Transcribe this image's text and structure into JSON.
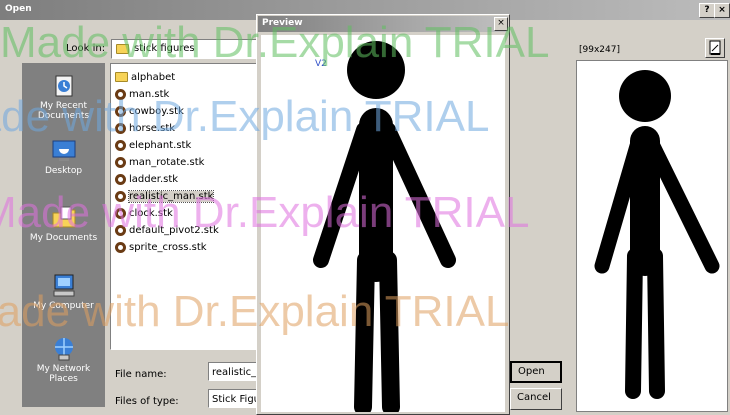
{
  "dialog": {
    "title": "Open",
    "help_label": "?",
    "close_label": "×",
    "look_in_label": "Look in:",
    "look_in_value": "stick figures",
    "dims_text": "[99x247]",
    "file_name_label": "File name:",
    "file_name_value": "realistic_m",
    "file_type_label": "Files of type:",
    "file_type_value": "Stick Figu",
    "open_label": "Open",
    "cancel_label": "Cancel"
  },
  "places": [
    {
      "label": "My Recent Documents",
      "icon": "recent-documents-icon"
    },
    {
      "label": "Desktop",
      "icon": "desktop-icon"
    },
    {
      "label": "My Documents",
      "icon": "my-documents-icon"
    },
    {
      "label": "My Computer",
      "icon": "my-computer-icon"
    },
    {
      "label": "My Network Places",
      "icon": "network-places-icon"
    }
  ],
  "files": [
    {
      "name": "alphabet",
      "type": "folder"
    },
    {
      "name": "man.stk",
      "type": "stk"
    },
    {
      "name": "cowboy.stk",
      "type": "stk"
    },
    {
      "name": "horse.stk",
      "type": "stk"
    },
    {
      "name": "elephant.stk",
      "type": "stk"
    },
    {
      "name": "man_rotate.stk",
      "type": "stk"
    },
    {
      "name": "ladder.stk",
      "type": "stk"
    },
    {
      "name": "realistic_man.stk",
      "type": "stk",
      "selected": true
    },
    {
      "name": "clock.stk",
      "type": "stk"
    },
    {
      "name": "default_pivot2.stk",
      "type": "stk"
    },
    {
      "name": "sprite_cross.stk",
      "type": "stk"
    }
  ],
  "preview_window": {
    "title": "Preview",
    "close_label": "×",
    "version_label": "V2"
  },
  "watermark": {
    "text": "Made with Dr.Explain TRIAL",
    "colors": [
      "#5fbf5f",
      "#6fa8e0",
      "#e070e0",
      "#e0a060"
    ]
  }
}
